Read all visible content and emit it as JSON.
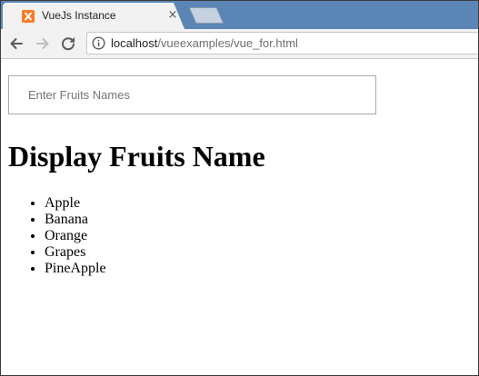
{
  "browser": {
    "tab": {
      "title": "VueJs Instance",
      "favicon_icon": "xampp-icon",
      "close_glyph": "×"
    },
    "toolbar": {
      "back_icon": "back-arrow-icon",
      "forward_icon": "forward-arrow-icon",
      "reload_icon": "reload-icon",
      "info_icon": "info-icon"
    },
    "url": {
      "host": "localhost",
      "path": "/vueexamples/vue_for.html"
    }
  },
  "page": {
    "input": {
      "placeholder": "Enter Fruits Names",
      "value": ""
    },
    "heading": "Display Fruits Name",
    "fruits": [
      "Apple",
      "Banana",
      "Orange",
      "Grapes",
      "PineApple"
    ]
  },
  "colors": {
    "tabstrip": "#5b85b5",
    "favicon": "#fb7a24"
  }
}
